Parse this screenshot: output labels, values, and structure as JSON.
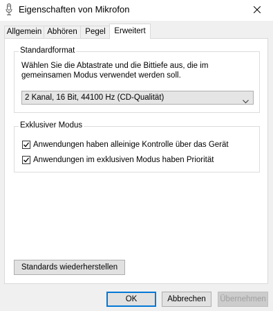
{
  "window": {
    "title": "Eigenschaften von Mikrofon",
    "title_icon": "microphone-icon",
    "close_icon": "close-icon"
  },
  "tabs": [
    {
      "label": "Allgemein",
      "active": false
    },
    {
      "label": "Abhören",
      "active": false
    },
    {
      "label": "Pegel",
      "active": false
    },
    {
      "label": "Erweitert",
      "active": true
    }
  ],
  "standardformat": {
    "legend": "Standardformat",
    "description": "Wählen Sie die Abtastrate und die Bittiefe aus, die im gemeinsamen Modus verwendet werden soll.",
    "selected_format": "2 Kanal, 16 Bit, 44100 Hz (CD-Qualität)"
  },
  "exclusive_mode": {
    "legend": "Exklusiver Modus",
    "options": [
      {
        "label": "Anwendungen haben alleinige Kontrolle über das Gerät",
        "checked": true
      },
      {
        "label": "Anwendungen im exklusiven Modus haben Priorität",
        "checked": true
      }
    ]
  },
  "restore_defaults_label": "Standards wiederherstellen",
  "footer": {
    "ok_label": "OK",
    "cancel_label": "Abbrechen",
    "apply_label": "Übernehmen"
  },
  "colors": {
    "accent": "#0078d7",
    "window_bg": "#f0f0f0",
    "panel_bg": "#ffffff"
  }
}
